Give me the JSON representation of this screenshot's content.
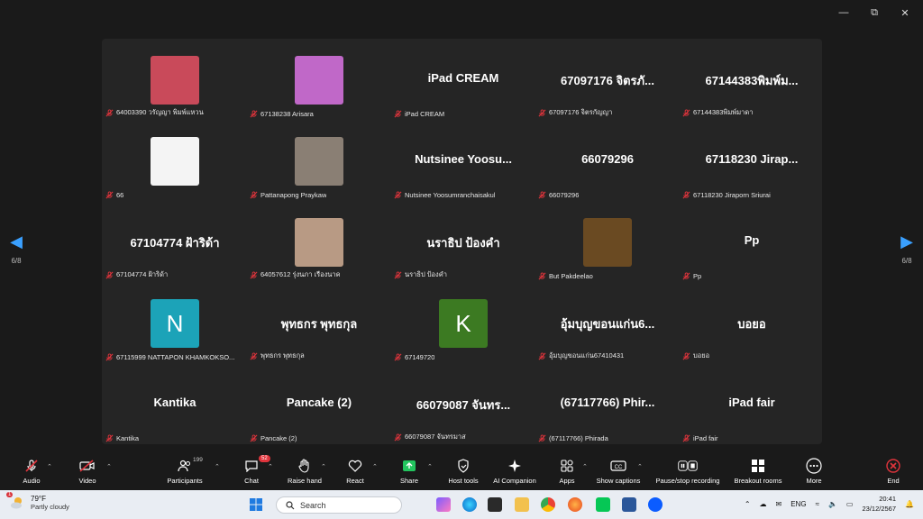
{
  "participants": [
    {
      "big": "",
      "caption": "64003390 วรัญญา พิมพ์แหวน",
      "kind": "photo",
      "color": "#c94a5a"
    },
    {
      "big": "",
      "caption": "67138238 Arisara",
      "kind": "photo",
      "color": "#c068c8"
    },
    {
      "big": "iPad  CREAM",
      "caption": "iPad CREAM",
      "kind": "text",
      "color": ""
    },
    {
      "big": "67097176 จิตรภั...",
      "caption": "67097176 จิตรกัญญา",
      "kind": "text",
      "color": ""
    },
    {
      "big": "67144383พิมพ์ม...",
      "caption": "67144383พิมพ์มาดา",
      "kind": "text",
      "color": ""
    },
    {
      "big": "",
      "caption": "66",
      "kind": "photo",
      "color": "#f4f4f4"
    },
    {
      "big": "",
      "caption": "Pattanapong Praykaw",
      "kind": "photo",
      "color": "#8a7f74"
    },
    {
      "big": "Nutsinee  Yoosu...",
      "caption": "Nutsinee Yoosumranchaisakul",
      "kind": "text",
      "color": ""
    },
    {
      "big": "66079296",
      "caption": "66079296",
      "kind": "text",
      "color": ""
    },
    {
      "big": "67118230  Jirap...",
      "caption": "67118230 Jiraporn Sriurai",
      "kind": "text",
      "color": ""
    },
    {
      "big": "67104774 ฝ้าริด้า",
      "caption": "67104774 ฝ้าริด้า",
      "kind": "text",
      "color": ""
    },
    {
      "big": "",
      "caption": "64057612 รุ่งนภา เรืองนาค",
      "kind": "photo",
      "color": "#b89a84"
    },
    {
      "big": "นราธิป ป้องคำ",
      "caption": "นราธิป ป้องคำ",
      "kind": "text",
      "color": ""
    },
    {
      "big": "",
      "caption": "But Pakdeelao",
      "kind": "photo",
      "color": "#6a4a22"
    },
    {
      "big": "Pp",
      "caption": "Pp",
      "kind": "text",
      "color": ""
    },
    {
      "big": "N",
      "caption": "67115999 NATTAPON KHAMKOKSO...",
      "kind": "letter",
      "color": "#1ca3b8"
    },
    {
      "big": "พุทธกร พุทธกุล",
      "caption": "พุทธกร พุทธกุล",
      "kind": "text",
      "color": ""
    },
    {
      "big": "K",
      "caption": "67149720",
      "kind": "letter",
      "color": "#3c7a22"
    },
    {
      "big": "อุ้มบุญขอนแก่น6...",
      "caption": "อุ้มบุญขอนแก่น67410431",
      "kind": "text",
      "color": ""
    },
    {
      "big": "บอยอ",
      "caption": "บอยอ",
      "kind": "text",
      "color": ""
    },
    {
      "big": "Kantika",
      "caption": "Kantika",
      "kind": "text",
      "color": ""
    },
    {
      "big": "Pancake (2)",
      "caption": "Pancake (2)",
      "kind": "text",
      "color": ""
    },
    {
      "big": "66079087 จันทร...",
      "caption": "66079087 จันทรมาส",
      "kind": "text",
      "color": ""
    },
    {
      "big": "(67117766)  Phir...",
      "caption": "(67117766) Phirada",
      "kind": "text",
      "color": ""
    },
    {
      "big": "iPad fair",
      "caption": "iPad fair",
      "kind": "text",
      "color": ""
    }
  ],
  "pager": {
    "left": "6/8",
    "right": "6/8"
  },
  "toolbar": {
    "audio": "Audio",
    "video": "Video",
    "participants": "Participants",
    "participants_count": "199",
    "chat": "Chat",
    "chat_badge": "52",
    "raise_hand": "Raise hand",
    "react": "React",
    "share": "Share",
    "host_tools": "Host tools",
    "ai_companion": "AI Companion",
    "apps": "Apps",
    "show_captions": "Show captions",
    "pause_recording": "Pause/stop recording",
    "breakout_rooms": "Breakout rooms",
    "more": "More",
    "end": "End"
  },
  "taskbar": {
    "temp": "79°F",
    "weather": "Partly cloudy",
    "weather_badge": "1",
    "search_placeholder": "Search",
    "lang": "ENG",
    "time": "20:41",
    "date": "23/12/2567"
  },
  "colors": {
    "accent": "#3aa0ff",
    "muted_mic": "#e0343c",
    "end": "#e0343c",
    "share": "#22c55e"
  }
}
